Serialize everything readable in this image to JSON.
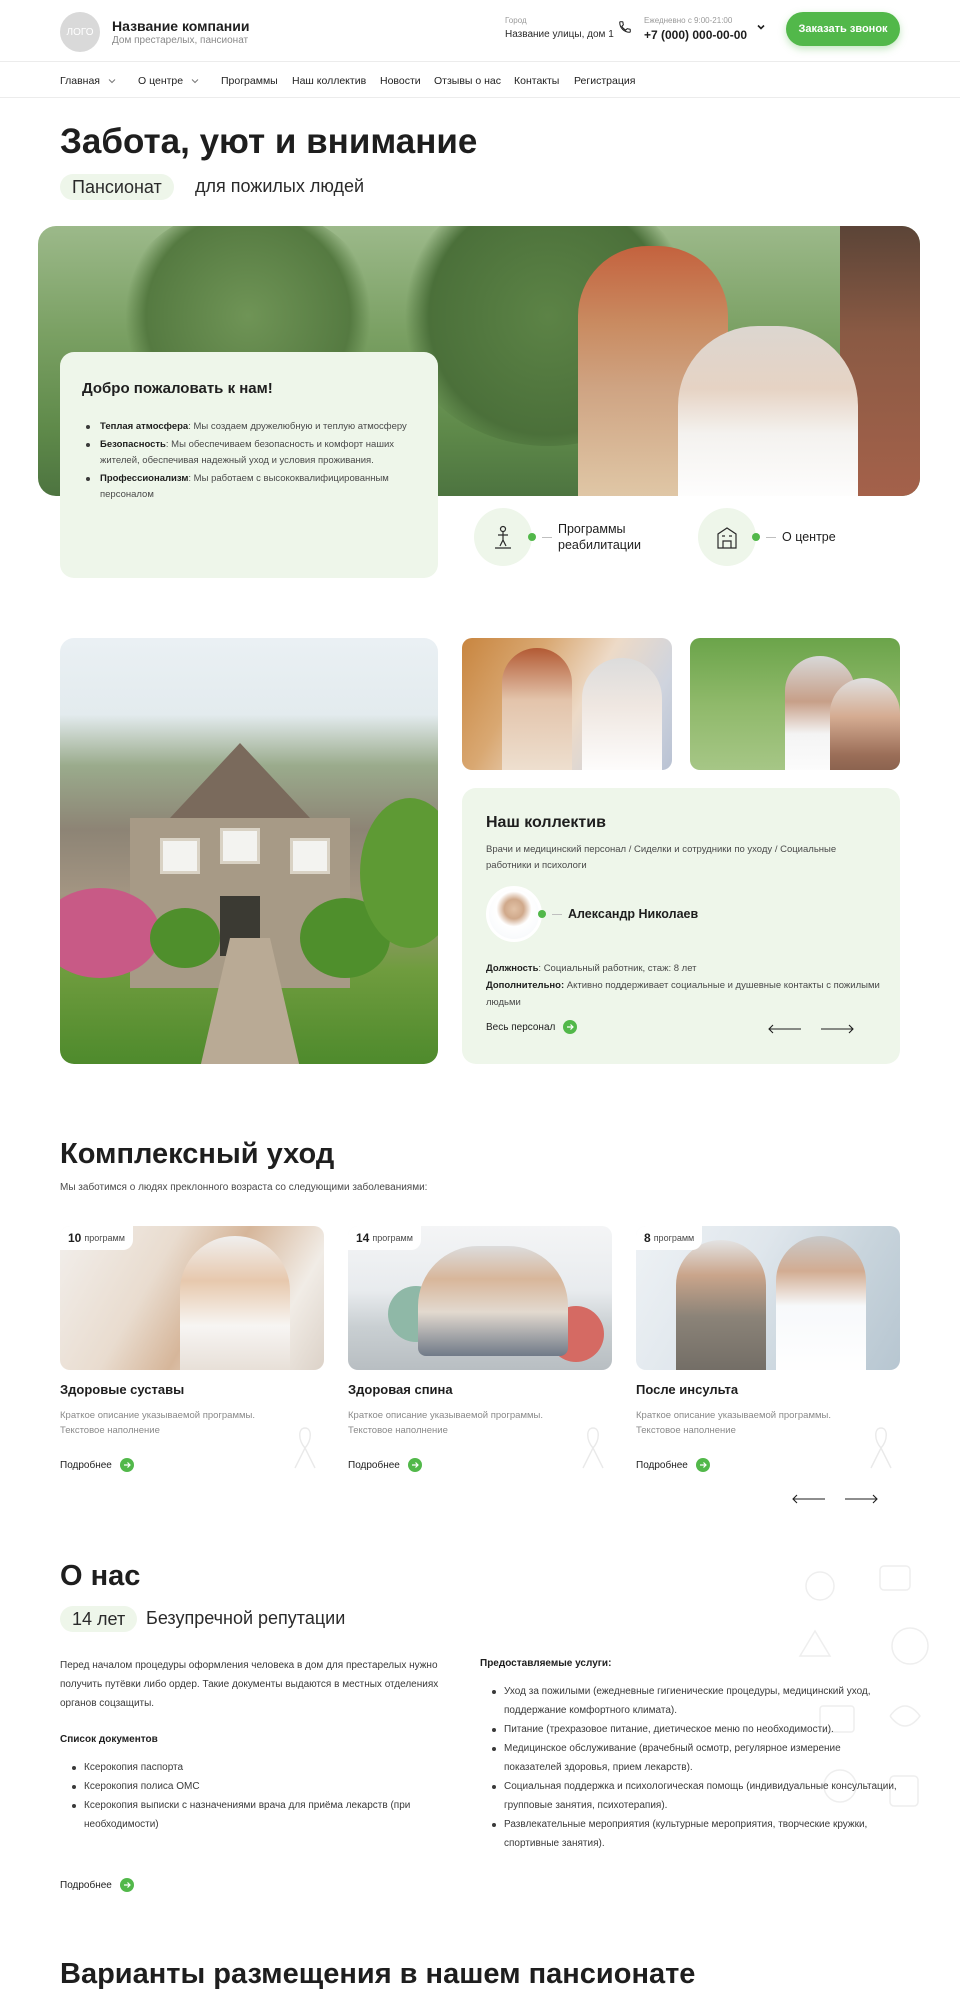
{
  "header": {
    "logo_text": "ЛОГО",
    "company_name": "Название компании",
    "company_sub": "Дом престарелых, пансионат",
    "city_label": "Город",
    "address": "Название улицы, дом 1",
    "hours": "Ежедневно с 9:00-21:00",
    "phone": "+7 (000) 000-00-00",
    "call_button": "Заказать звонок"
  },
  "nav": {
    "items": [
      "Главная",
      "О центре",
      "Программы",
      "Наш коллектив",
      "Новости",
      "Отзывы о нас",
      "Контакты",
      "Регистрация"
    ]
  },
  "hero": {
    "title": "Забота, уют и внимание",
    "pill": "Пансионат",
    "subtitle": "для пожилых людей",
    "welcome_title": "Добро пожаловать к нам!",
    "bullets": [
      {
        "bold": "Теплая атмосфера",
        "text": ": Мы создаем дружелюбную и теплую атмосферу"
      },
      {
        "bold": "Безопасность",
        "text": ": Мы обеспечиваем безопасность и комфорт наших жителей, обеспечивая надежный уход и условия проживания."
      },
      {
        "bold": "Профессионализм",
        "text": ": Мы работаем с высококвалифицированным персоналом"
      }
    ],
    "quick_links": [
      {
        "label_line1": "Программы",
        "label_line2": "реабилитации",
        "icon": "rehab-icon"
      },
      {
        "label_line1": "О центре",
        "label_line2": "",
        "icon": "building-icon"
      }
    ]
  },
  "team": {
    "title": "Наш коллектив",
    "roles": "Врачи и медицинский персонал / Сиделки и сотрудники по уходу / Социальные работники и психологи",
    "member_name": "Александр Николаев",
    "position_label": "Должность",
    "position_text": ": Социальный работник, стаж: 8 лет",
    "extra_label": "Дополнительно:",
    "extra_text": " Активно поддерживает социальные и душевные контакты с пожилыми людьми",
    "all_staff_link": "Весь персонал"
  },
  "care": {
    "title": "Комплексный уход",
    "subtitle": "Мы заботимся о людях преклонного возраста со следующими заболеваниями:",
    "programs_word": "программ",
    "cards": [
      {
        "count": "10",
        "name": "Здоровые суставы",
        "desc": "Краткое описание указываемой программы. Текстовое наполнение",
        "link": "Подробнее"
      },
      {
        "count": "14",
        "name": "Здоровая спина",
        "desc": "Краткое описание указываемой программы. Текстовое наполнение",
        "link": "Подробнее"
      },
      {
        "count": "8",
        "name": "После инсульта",
        "desc": "Краткое описание указываемой программы. Текстовое наполнение",
        "link": "Подробнее"
      }
    ]
  },
  "about": {
    "title": "О нас",
    "pill": "14 лет",
    "subtitle": "Безупречной репутации",
    "intro": "Перед началом процедуры оформления человека в дом для престарелых нужно получить путёвки либо ордер. Такие документы выдаются в местных отделениях органов соцзащиты.",
    "docs_title": "Список документов",
    "docs": [
      "Ксерокопия паспорта",
      "Ксерокопия полиса ОМС",
      "Ксерокопия выписки с назначениями врача для приёма лекарств (при необходимости)"
    ],
    "services_title": "Предоставляемые услуги:",
    "services": [
      "Уход за пожилыми (ежедневные гигиенические процедуры, медицинский уход, поддержание комфортного климата).",
      "Питание (трехразовое питание, диетическое меню по необходимости).",
      "Медицинское обслуживание (врачебный осмотр, регулярное измерение показателей здоровья, прием лекарств).",
      "Социальная поддержка и психологическая помощь (индивидуальные консультации, групповые занятия, психотерапия).",
      "Развлекательные мероприятия (культурные мероприятия, творческие кружки, спортивные занятия)."
    ],
    "more_link": "Подробнее"
  },
  "placement": {
    "title": "Варианты размещения в нашем пансионате"
  },
  "colors": {
    "accent": "#52b84a",
    "card_bg": "#eef6ea",
    "text": "#1e1e1e"
  }
}
